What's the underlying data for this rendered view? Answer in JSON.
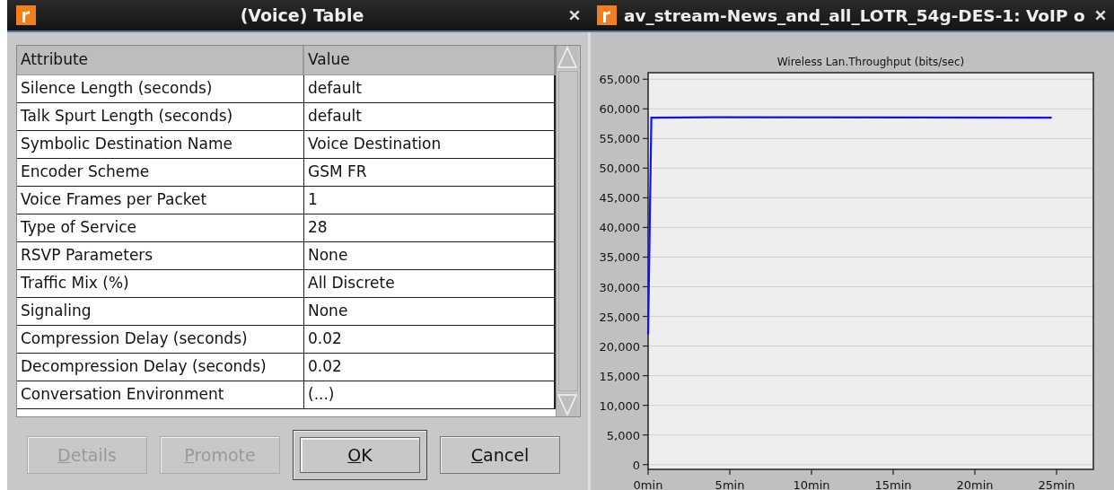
{
  "dialog": {
    "title": "(Voice) Table",
    "table": {
      "columns": [
        "Attribute",
        "Value"
      ],
      "rows": [
        {
          "attribute": "Silence Length (seconds)",
          "value": "default"
        },
        {
          "attribute": "Talk Spurt Length (seconds)",
          "value": "default"
        },
        {
          "attribute": "Symbolic Destination Name",
          "value": "Voice Destination"
        },
        {
          "attribute": "Encoder Scheme",
          "value": "GSM FR"
        },
        {
          "attribute": "Voice Frames per Packet",
          "value": "1"
        },
        {
          "attribute": "Type of Service",
          "value": "28"
        },
        {
          "attribute": "RSVP Parameters",
          "value": "None"
        },
        {
          "attribute": "Traffic Mix (%)",
          "value": "All Discrete"
        },
        {
          "attribute": "Signaling",
          "value": "None"
        },
        {
          "attribute": "Compression Delay (seconds)",
          "value": "0.02"
        },
        {
          "attribute": "Decompression Delay (seconds)",
          "value": "0.02"
        },
        {
          "attribute": "Conversation Environment",
          "value": "(...)"
        }
      ]
    },
    "buttons": [
      {
        "label": "Details",
        "disabled": true,
        "default": false
      },
      {
        "label": "Promote",
        "disabled": true,
        "default": false
      },
      {
        "label": "OK",
        "disabled": false,
        "default": true
      },
      {
        "label": "Cancel",
        "disabled": false,
        "default": false
      }
    ]
  },
  "graph_window": {
    "title": "av_stream-News_and_all_LOTR_54g-DES-1: VoIP o",
    "chart_data": {
      "type": "line",
      "title": "Wireless Lan.Throughput (bits/sec)",
      "x": [
        0,
        0.2,
        4,
        24.7
      ],
      "series": [
        {
          "color": "#1010ff",
          "values": [
            22000,
            58500,
            58600,
            58500
          ]
        }
      ],
      "grid": true,
      "xlim": [
        0,
        27.25
      ],
      "ylim": [
        -800,
        66100
      ],
      "xticks": [
        {
          "value": 0,
          "label": "0min"
        },
        {
          "value": 5,
          "label": "5min"
        },
        {
          "value": 10,
          "label": "10min"
        },
        {
          "value": 15,
          "label": "15min"
        },
        {
          "value": 20,
          "label": "20min"
        },
        {
          "value": 25,
          "label": "25min"
        }
      ],
      "yticks": [
        {
          "value": 0,
          "label": "0"
        },
        {
          "value": 5000,
          "label": "5,000"
        },
        {
          "value": 10000,
          "label": "10,000"
        },
        {
          "value": 15000,
          "label": "15,000"
        },
        {
          "value": 20000,
          "label": "20,000"
        },
        {
          "value": 25000,
          "label": "25,000"
        },
        {
          "value": 30000,
          "label": "30,000"
        },
        {
          "value": 35000,
          "label": "35,000"
        },
        {
          "value": 40000,
          "label": "40,000"
        },
        {
          "value": 45000,
          "label": "45,000"
        },
        {
          "value": 50000,
          "label": "50,000"
        },
        {
          "value": 55000,
          "label": "55,000"
        },
        {
          "value": 60000,
          "label": "60,000"
        },
        {
          "value": 65000,
          "label": "65,000"
        }
      ]
    }
  }
}
